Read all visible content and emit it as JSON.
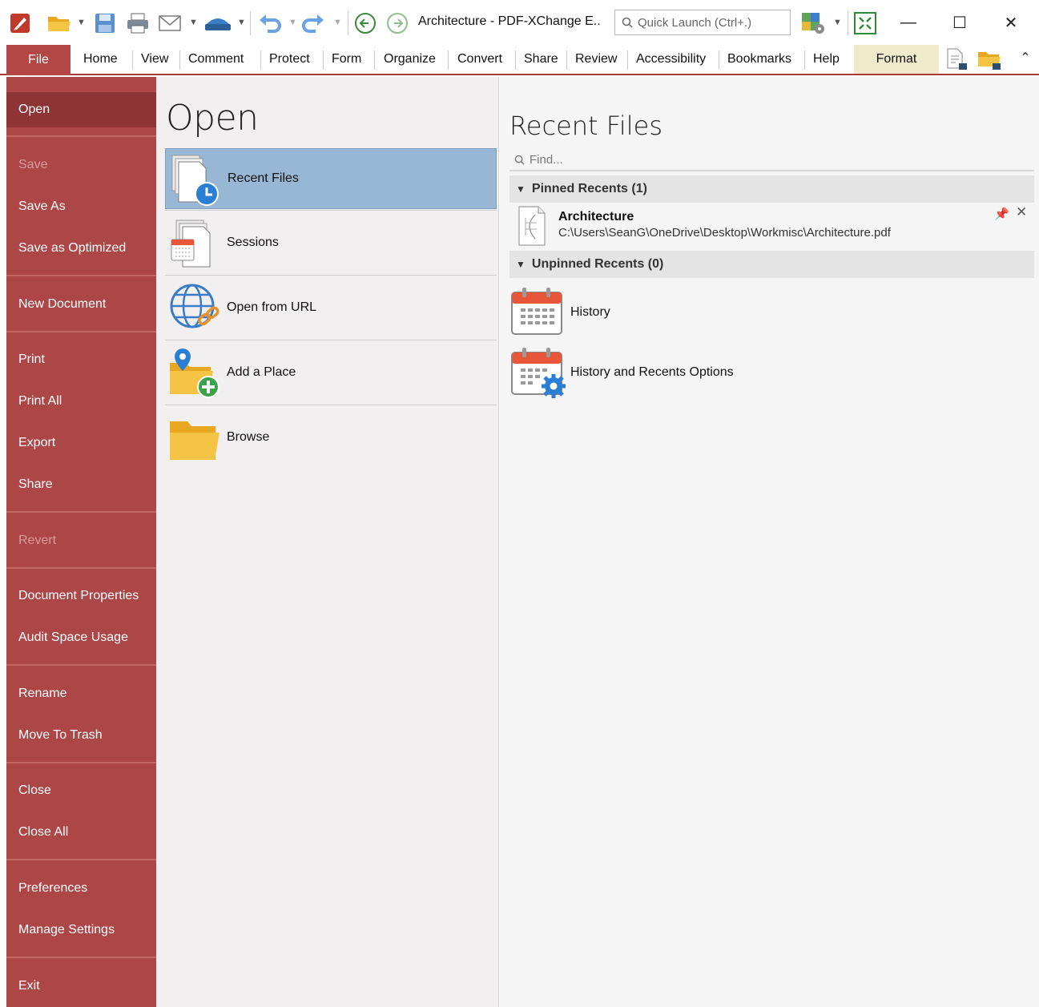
{
  "titlebar": {
    "title": "Architecture - PDF-XChange E..",
    "quick_launch_placeholder": "Quick Launch (Ctrl+.)"
  },
  "ribbon": {
    "file_tab": "File",
    "tabs": [
      "Home",
      "View",
      "Comment",
      "Protect",
      "Form",
      "Organize",
      "Convert",
      "Share",
      "Review",
      "Accessibility",
      "Bookmarks",
      "Help"
    ],
    "context_tab": "Format"
  },
  "sidebar": {
    "items": [
      {
        "label": "Open",
        "state": "active"
      },
      {
        "label": "Save",
        "state": "disabled"
      },
      {
        "label": "Save As",
        "state": "normal"
      },
      {
        "label": "Save as Optimized",
        "state": "normal"
      },
      {
        "label": "New Document",
        "state": "normal"
      },
      {
        "label": "Print",
        "state": "normal"
      },
      {
        "label": "Print All",
        "state": "normal"
      },
      {
        "label": "Export",
        "state": "normal"
      },
      {
        "label": "Share",
        "state": "normal"
      },
      {
        "label": "Revert",
        "state": "disabled"
      },
      {
        "label": "Document Properties",
        "state": "normal"
      },
      {
        "label": "Audit Space Usage",
        "state": "normal"
      },
      {
        "label": "Rename",
        "state": "normal"
      },
      {
        "label": "Move To Trash",
        "state": "normal"
      },
      {
        "label": "Close",
        "state": "normal"
      },
      {
        "label": "Close All",
        "state": "normal"
      },
      {
        "label": "Preferences",
        "state": "normal"
      },
      {
        "label": "Manage Settings",
        "state": "normal"
      },
      {
        "label": "Exit",
        "state": "normal"
      }
    ]
  },
  "open_panel": {
    "title": "Open",
    "options": [
      {
        "label": "Recent Files",
        "icon": "recent-files-icon",
        "selected": true
      },
      {
        "label": "Sessions",
        "icon": "sessions-icon",
        "selected": false
      },
      {
        "label": "Open from URL",
        "icon": "open-url-icon",
        "selected": false
      },
      {
        "label": "Add a Place",
        "icon": "add-place-icon",
        "selected": false
      },
      {
        "label": "Browse",
        "icon": "browse-folder-icon",
        "selected": false
      }
    ]
  },
  "recent_panel": {
    "title": "Recent Files",
    "find_placeholder": "Find...",
    "pinned_header": "Pinned Recents (1)",
    "pinned_files": [
      {
        "name": "Architecture",
        "path": "C:\\Users\\SeanG\\OneDrive\\Desktop\\Workmisc\\Architecture.pdf"
      }
    ],
    "unpinned_header": "Unpinned Recents (0)",
    "actions": [
      {
        "label": "History",
        "icon": "calendar-icon"
      },
      {
        "label": "History and Recents Options",
        "icon": "calendar-gear-icon"
      }
    ]
  },
  "colors": {
    "sidebar": "#ad4747",
    "sidebar_active": "#8e3434",
    "selected_option": "#97b7d5",
    "format_tab": "#eeeacb"
  }
}
